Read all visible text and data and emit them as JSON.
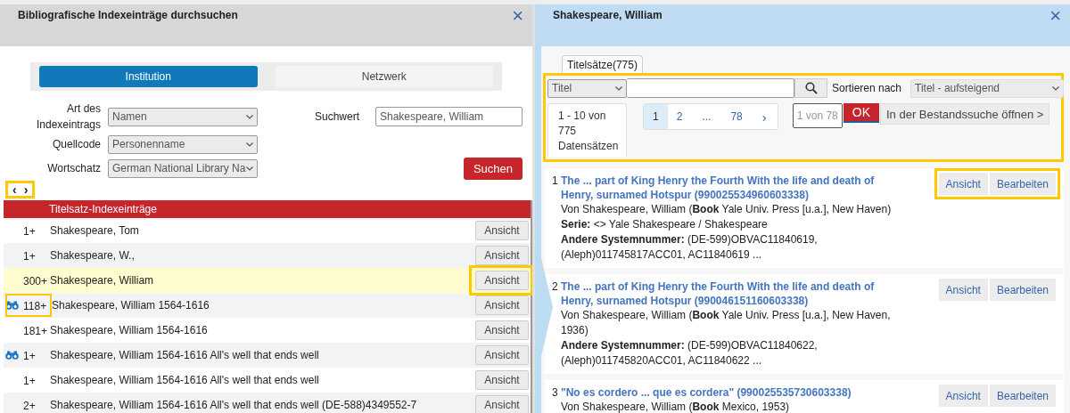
{
  "left_dialog": {
    "title": "Bibliografische Indexeinträge durchsuchen",
    "close": "×",
    "scope_tabs": [
      {
        "label": "Institution",
        "selected": true
      },
      {
        "label": "Netzwerk",
        "selected": false
      }
    ],
    "form": {
      "index_type": {
        "label": "Art des Indexeintrags",
        "value": "Namen"
      },
      "source_code": {
        "label": "Quellcode",
        "value": "Personenname"
      },
      "vocabulary": {
        "label": "Wortschatz",
        "value": "German National Library Na"
      },
      "search_value": {
        "label": "Suchwert",
        "value": "Shakespeare, William"
      },
      "search_button": "Suchen"
    },
    "nav": {
      "prev": "‹",
      "next": "›",
      "highlighted": true
    },
    "table": {
      "heading": "Titelsatz-Indexeinträge",
      "rows": [
        {
          "count": "1+",
          "name": "Shakespeare, Tom",
          "button": "Ansicht",
          "linked": false,
          "selected": false,
          "count_highlighted": false,
          "button_highlighted": false
        },
        {
          "count": "1+",
          "name": "Shakespeare, W.,",
          "button": "Ansicht",
          "linked": false,
          "selected": false,
          "count_highlighted": false,
          "button_highlighted": false
        },
        {
          "count": "300+",
          "name": "Shakespeare, William",
          "button": "Ansicht",
          "linked": false,
          "selected": true,
          "count_highlighted": false,
          "button_highlighted": true
        },
        {
          "count": "118+",
          "name": "Shakespeare, William 1564-1616",
          "button": "Ansicht",
          "linked": true,
          "selected": false,
          "count_highlighted": true,
          "button_highlighted": false
        },
        {
          "count": "181+",
          "name": "Shakespeare, William 1564-1616",
          "button": "Ansicht",
          "linked": false,
          "selected": false,
          "count_highlighted": false,
          "button_highlighted": false
        },
        {
          "count": "1+",
          "name": "Shakespeare, William 1564-1616 All's well that ends well",
          "button": "Ansicht",
          "linked": true,
          "selected": false,
          "count_highlighted": false,
          "button_highlighted": false
        },
        {
          "count": "1+",
          "name": "Shakespeare, William 1564-1616 All's well that ends well",
          "button": "Ansicht",
          "linked": false,
          "selected": false,
          "count_highlighted": false,
          "button_highlighted": false
        },
        {
          "count": "2+",
          "name": "Shakespeare, William 1564-1616 All's well that ends well (DE-588)4349552-7",
          "button": "Ansicht",
          "linked": false,
          "selected": false,
          "count_highlighted": false,
          "button_highlighted": false
        }
      ]
    }
  },
  "right_dialog": {
    "title": "Shakespeare, William",
    "close": "×",
    "tab": {
      "label": "Titelsätze(775)",
      "selected": true
    },
    "toolbar": {
      "highlighted": true,
      "field_select": "Titel",
      "sort_label": "Sortieren nach",
      "sort_value": "Titel - aufsteigend",
      "range": "1 - 10 von 775 Datensätzen",
      "pages": [
        {
          "kind": "page",
          "label": "1",
          "selected": true
        },
        {
          "kind": "page",
          "label": "2",
          "selected": false
        },
        {
          "kind": "ellipsis",
          "label": "...",
          "selected": false
        },
        {
          "kind": "page",
          "label": "78",
          "selected": false
        },
        {
          "kind": "next",
          "label": "›",
          "selected": false
        }
      ],
      "page_input": {
        "placeholder": "1 von 78"
      },
      "ok": "OK",
      "open_button": "In der Bestandssuche öffnen >"
    },
    "results": [
      {
        "number": "1",
        "title": "The ... part of King Henry the Fourth With the life and death of Henry, surnamed Hotspur (990025534960603338)",
        "lines": [
          "Von Shakespeare, William (**Book** Yale Univ. Press [u.a.], New Haven)",
          "**Serie:** <> Yale Shakespeare / Shakespeare",
          "**Andere Systemnummer:** (DE-599)OBVAC11840619, (Aleph)011745817ACC01, AC11840619 ..."
        ],
        "view": "Ansicht",
        "edit": "Bearbeiten",
        "actions_highlighted": true
      },
      {
        "number": "2",
        "title": "The ... part of King Henry the Fourth With the life and death of Henry, surnamed Hotspur (990046151160603338)",
        "lines": [
          "Von Shakespeare, William (**Book** Yale Univ. Press [u.a.], New Haven, 1936)",
          "**Andere Systemnummer:** (DE-599)OBVAC11840622, (Aleph)011745820ACC01, AC11840622 ..."
        ],
        "view": "Ansicht",
        "edit": "Bearbeiten",
        "actions_highlighted": false
      },
      {
        "number": "3",
        "title": "\"No es cordero ... que es cordera\" (990025535730603338)",
        "lines": [
          "Von Shakespeare, William (**Book** Mexico, 1953)"
        ],
        "view": "Ansicht",
        "edit": "Bearbeiten",
        "actions_highlighted": false
      }
    ]
  }
}
